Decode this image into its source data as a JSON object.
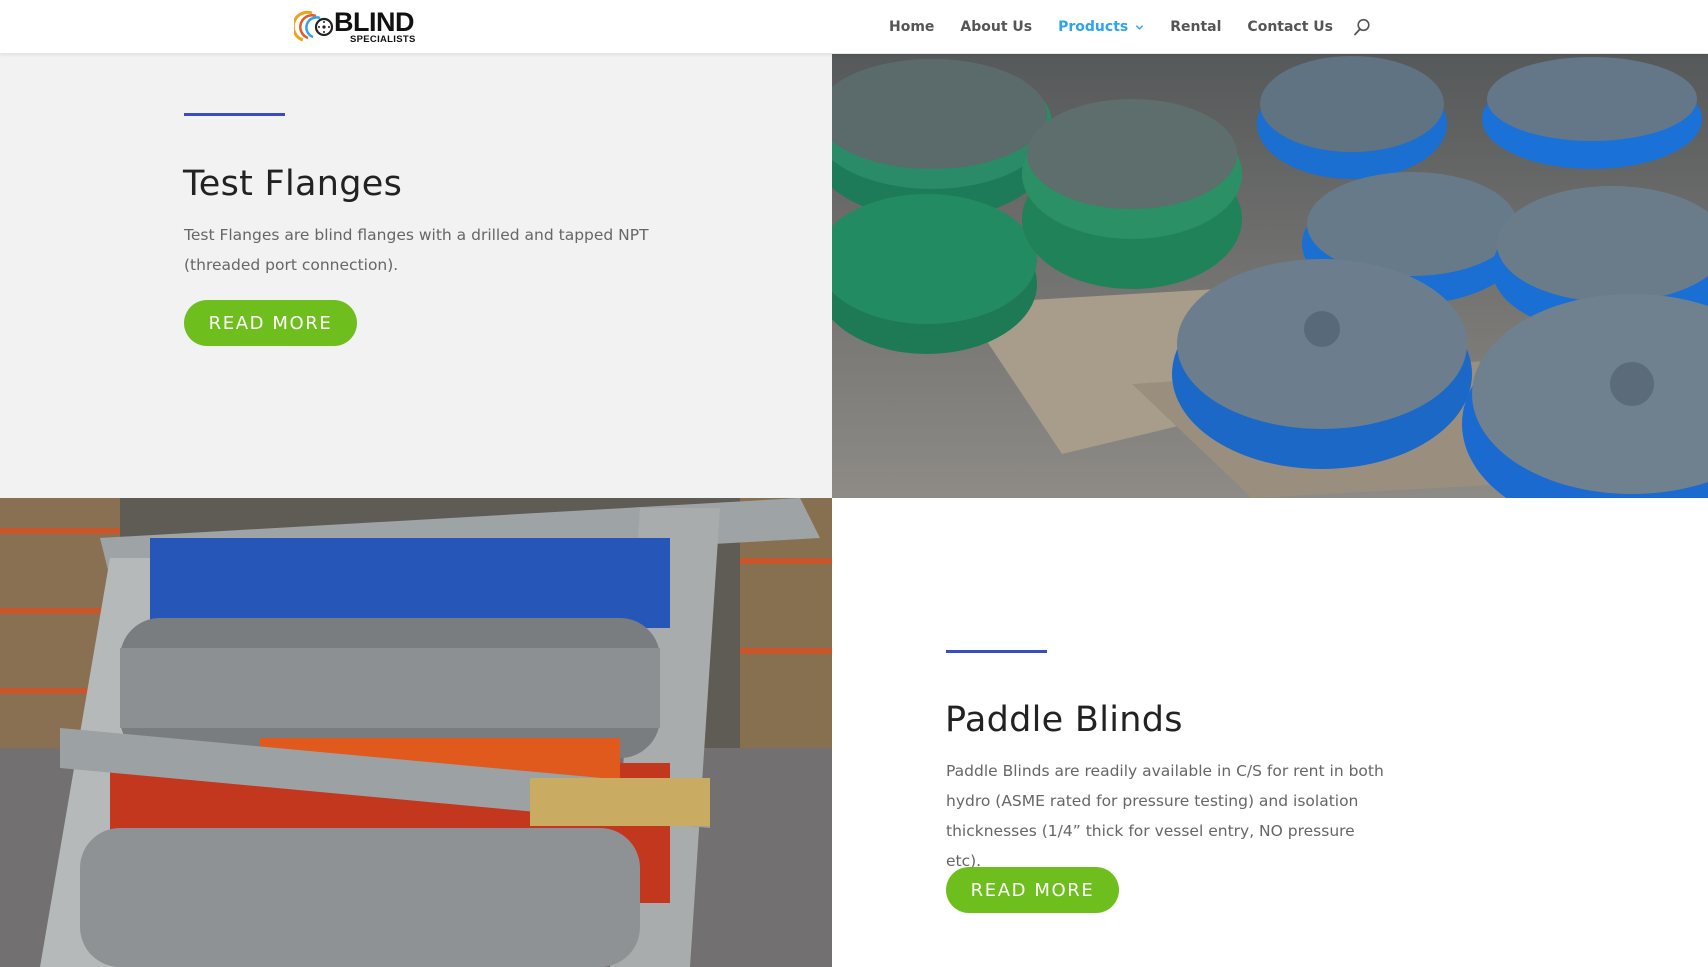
{
  "brand": {
    "name": "BLIND",
    "tagline": "SPECIALISTS"
  },
  "nav": {
    "items": [
      {
        "label": "Home"
      },
      {
        "label": "About Us"
      },
      {
        "label": "Products",
        "active": true,
        "has_dropdown": true
      },
      {
        "label": "Rental"
      },
      {
        "label": "Contact Us"
      }
    ],
    "search_icon": "search-icon",
    "active_color": "#2ea3f2"
  },
  "sections": [
    {
      "title": "Test Flanges",
      "text": "Test Flanges are blind flanges with a drilled and tapped NPT (threaded port connection).",
      "button": "READ MORE"
    },
    {
      "title": "Paddle Blinds",
      "text": "Paddle Blinds are readily available in C/S for rent in both hydro (ASME rated for pressure testing) and isolation thicknesses (1/4” thick for vessel entry, NO pressure etc).",
      "button": "READ MORE"
    }
  ],
  "colors": {
    "accent_line": "#3a4cc4",
    "button": "#6ebe1e"
  }
}
